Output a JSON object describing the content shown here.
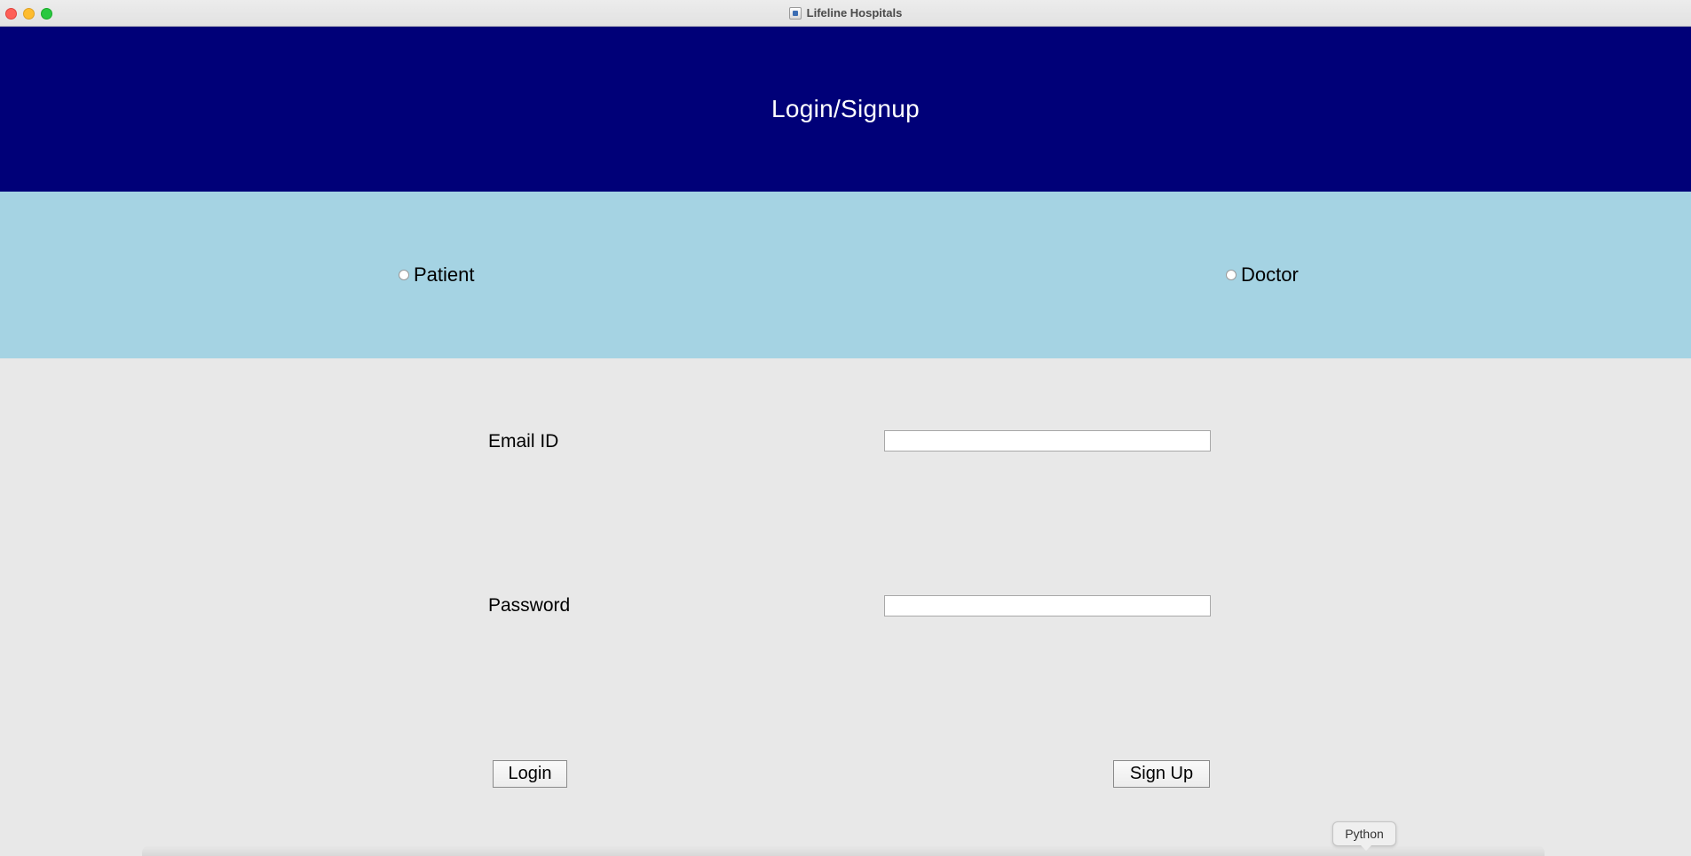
{
  "window": {
    "title": "Lifeline Hospitals",
    "app_icon": "python-app-icon"
  },
  "header": {
    "title": "Login/Signup",
    "background": "#000078"
  },
  "roles": {
    "background": "#a5d3e3",
    "options": [
      {
        "label": "Patient",
        "selected": false
      },
      {
        "label": "Doctor",
        "selected": false
      }
    ]
  },
  "form": {
    "email_label": "Email ID",
    "email_value": "",
    "password_label": "Password",
    "password_value": ""
  },
  "buttons": {
    "login_label": "Login",
    "signup_label": "Sign Up"
  },
  "dock_tooltip": "Python"
}
